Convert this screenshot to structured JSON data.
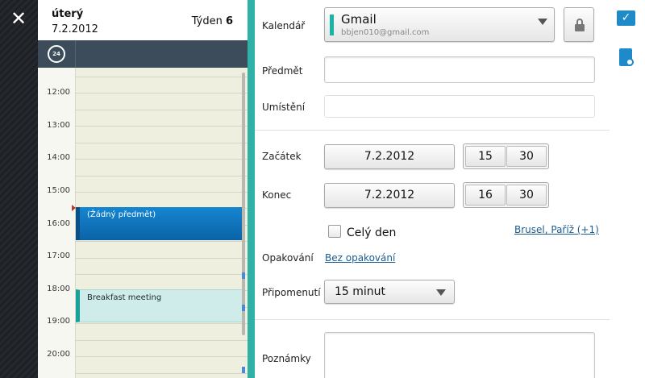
{
  "nav": {
    "close_glyph": "✕"
  },
  "day_panel": {
    "day_name": "úterý",
    "date": "7.2.2012",
    "week_label": "Týden",
    "week_number": "6",
    "clock_button_text": "24",
    "hours": [
      "12:00",
      "13:00",
      "14:00",
      "15:00",
      "16:00",
      "17:00",
      "18:00",
      "19:00",
      "20:00"
    ],
    "events": [
      {
        "title": "(Žádný předmět)"
      },
      {
        "title": "Breakfast meeting"
      }
    ]
  },
  "form": {
    "calendar_label": "Kalendář",
    "calendar_name": "Gmail",
    "calendar_email": "bbjen010@gmail.com",
    "subject_label": "Předmět",
    "subject_value": "",
    "location_label": "Umístění",
    "location_value": "",
    "start_label": "Začátek",
    "start_date": "7.2.2012",
    "start_hour": "15",
    "start_minute": "30",
    "end_label": "Konec",
    "end_date": "7.2.2012",
    "end_hour": "16",
    "end_minute": "30",
    "all_day_label": "Celý den",
    "timezone_link": "Brusel, Paříž (+1)",
    "repeat_label": "Opakování",
    "repeat_value": "Bez opakování",
    "reminder_label": "Připomenutí",
    "reminder_value": "15 minut",
    "notes_label": "Poznámky",
    "notes_value": ""
  },
  "colors": {
    "accent": "#2fb1a7",
    "event_blue": "#0b63a6",
    "event_teal": "#cfecea",
    "link": "#1c5c8f"
  },
  "icons": [
    "close-icon",
    "clock-24-icon",
    "lock-icon",
    "dropdown-arrow-icon",
    "check-icon",
    "document-icon"
  ]
}
